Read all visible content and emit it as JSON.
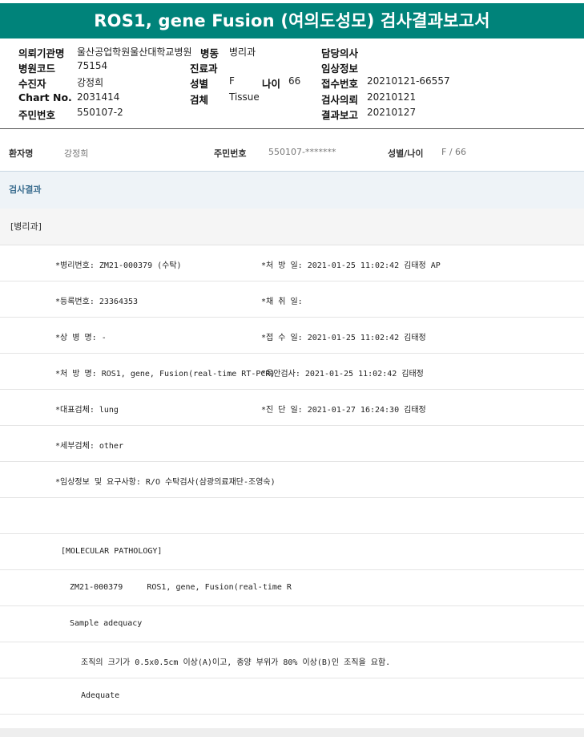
{
  "title": "ROS1, gene Fusion (여의도성모) 검사결과보고서",
  "info": {
    "hospital_label": "의뢰기관명",
    "hospital_value": "울산공업학원울산대학교병원",
    "ward_label": "병동",
    "ward_value": "병리과",
    "doctor_label": "담당의사",
    "code_label": "병원코드",
    "code_value": "75154",
    "dept_label": "진료과",
    "clinical_label": "임상정보",
    "collector_label": "수진자",
    "collector_value": "강정희",
    "sex_label": "성별",
    "sex_value": "F",
    "age_label": "나이",
    "age_value": "66",
    "receipt_label": "접수번호",
    "receipt_value": "20210121-66557",
    "chart_label": "Chart No.",
    "chart_value": "2031414",
    "specimen_label": "검체",
    "specimen_value": "Tissue",
    "request_label": "검사의뢰",
    "request_value": "20210121",
    "resident_label": "주민번호",
    "resident_value": "550107-2",
    "report_label": "결과보고",
    "report_value": "20210127"
  },
  "patient_bar": {
    "name_label": "환자명",
    "name_value": "강정희",
    "resident_label": "주민번호",
    "resident_value": "550107-*******",
    "sexage_label": "성별/나이",
    "sexage_value": "F / 66"
  },
  "section_result": "검사결과",
  "section_dept": "[병리과]",
  "rows": [
    {
      "left": "*병리번호: ZM21-000379 (수탁)",
      "right": "*처 방 일: 2021-01-25 11:02:42  김태정 AP"
    },
    {
      "left": "*등록번호: 23364353",
      "right": "*채 취 일:"
    },
    {
      "left": "*상 병 명: -",
      "right": "*접 수 일: 2021-01-25 11:02:42  김태정"
    },
    {
      "left": "*처 방 명: ROS1, gene, Fusion(real-time RT-PCR)",
      "right": "*육안검사: 2021-01-25 11:02:42  김태정"
    },
    {
      "left": "*대표검체: lung",
      "right": "*진 단 일: 2021-01-27 16:24:30  김태정"
    },
    {
      "left": "*세부검체: other",
      "right": ""
    },
    {
      "left": "*임상정보 및 요구사항: R/O 수탁검사(삼광의료재단-조영숙)",
      "right": ""
    },
    {
      "left": "",
      "right": ""
    },
    {
      "left": "[MOLECULAR PATHOLOGY]",
      "right": ""
    },
    {
      "left": "ZM21-000379     ROS1, gene, Fusion(real-time R",
      "right": ""
    },
    {
      "left": "Sample adequacy",
      "right": ""
    },
    {
      "left": "조직의 크기가 0.5x0.5cm 이상(A)이고, 종양 부위가 80% 이상(B)인 조직을 요함.",
      "right": ""
    },
    {
      "left": "Adequate",
      "right": ""
    }
  ]
}
